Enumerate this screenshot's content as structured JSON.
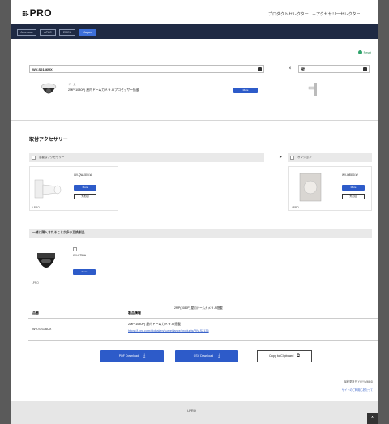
{
  "header": {
    "logo_text": "PRO",
    "link_product_selector": "プロダクトセレクター",
    "link_accessory_selector": "＋アクセサリーセレクター"
  },
  "region_tabs": [
    {
      "label": "Americas"
    },
    {
      "label": "APAC"
    },
    {
      "label": "EMEA"
    },
    {
      "label": "Japan"
    }
  ],
  "reset_label": "Reset",
  "selector": {
    "model_value": "WV-S2136UX",
    "right_value": "壁",
    "x_sep": "×",
    "category_label": "ドーム",
    "product_name": "2MP(1080P) 屋内ドームカメラ AIプロセッサー搭載",
    "more_label": "More"
  },
  "accessories": {
    "title": "取付アクセサリー",
    "required_label": "必要なアクセサリー",
    "optional_label": "オプション",
    "required_items": [
      {
        "model": "WV-QWL500-W",
        "more": "More",
        "outline": "外形図",
        "brand": "i-PRO"
      }
    ],
    "optional_items": [
      {
        "model": "WV-Q8500-W",
        "more": "More",
        "outline": "外形図",
        "brand": "i-PRO"
      }
    ],
    "arrow": "►"
  },
  "related": {
    "title": "一緒に購入されることが多い互換製品",
    "items": [
      {
        "model": "WV-CT55A",
        "more": "More",
        "brand": "i-PRO"
      }
    ]
  },
  "table": {
    "col_item": "品番",
    "col_info": "製品情報",
    "col_info_extra": "2MP(1080P) 屋内ドームカメラ AI搭載",
    "rows": [
      {
        "model": "WV-S2136UX",
        "desc": "2MP(1080P) 屋内ドームカメラ AI搭載",
        "url": "https://i-pro.com/global/en/surveillance/products/WV-S2136"
      }
    ]
  },
  "actions": {
    "pdf": "PDF Download",
    "csv": "CSV Download",
    "copy": "Copy to Clipboard"
  },
  "footer_notes": {
    "note1": "最終更新日 YYYYMMDD",
    "note2": "サイトのご利用にあたって"
  },
  "footer": {
    "text": "i-PRO"
  },
  "colors": {
    "accent": "#2d5bc9",
    "navbar": "#1f2a44",
    "reset": "#2fa36b"
  }
}
